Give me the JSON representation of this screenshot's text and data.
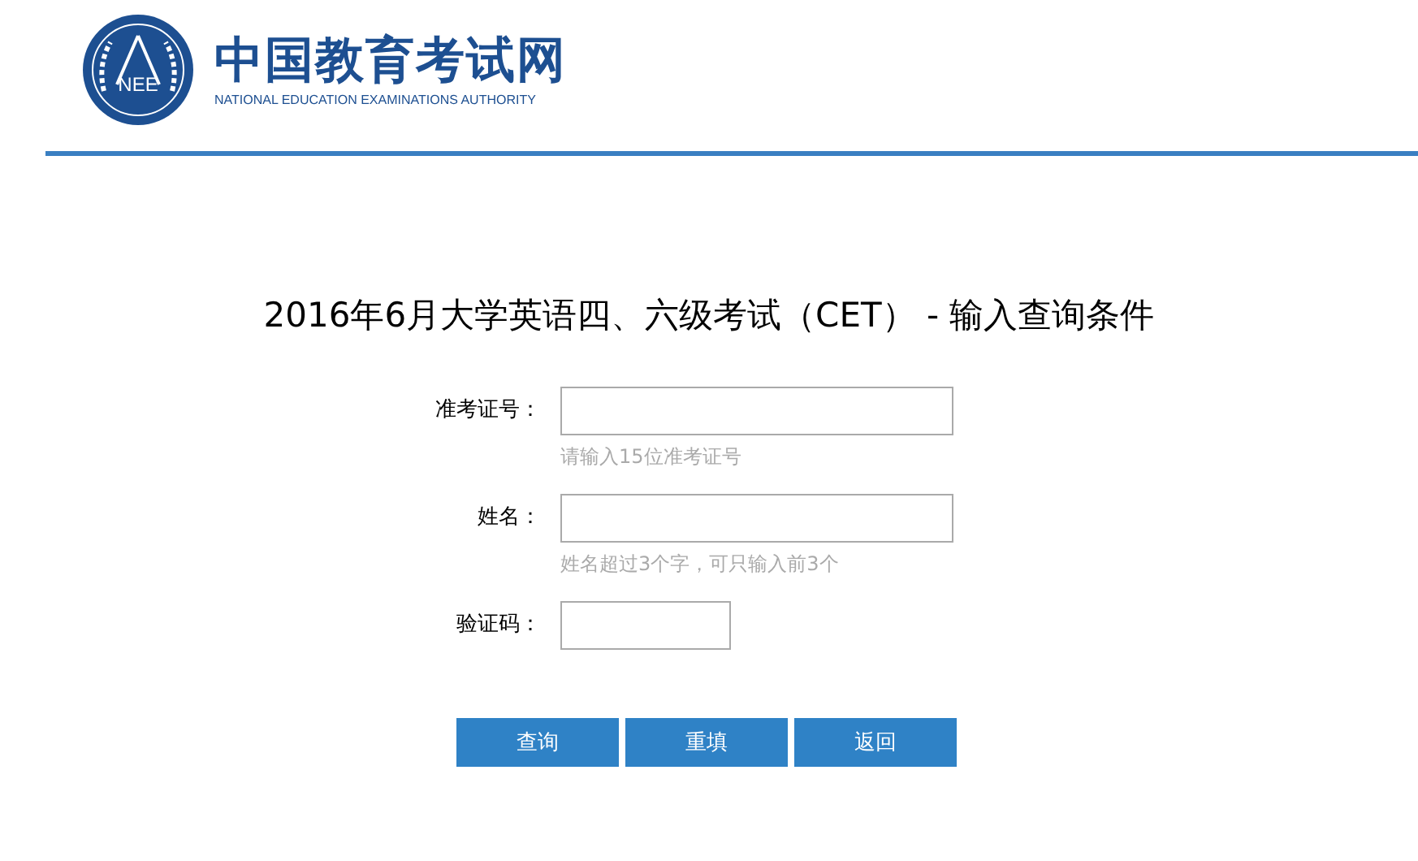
{
  "header": {
    "logo_mark": "NEE",
    "site_name": "中国教育考试网",
    "site_name_en": "NATIONAL EDUCATION EXAMINATIONS AUTHORITY"
  },
  "title": "2016年6月大学英语四、六级考试（CET） - 输入查询条件",
  "fields": [
    {
      "label": "准考证号：",
      "hint": "请输入15位准考证号",
      "kind": "wide"
    },
    {
      "label": "姓名：",
      "hint": "姓名超过3个字，可只输入前3个",
      "kind": "wide"
    },
    {
      "label": "验证码：",
      "kind": "short"
    }
  ],
  "buttons": [
    "查询",
    "重填",
    "返回"
  ]
}
